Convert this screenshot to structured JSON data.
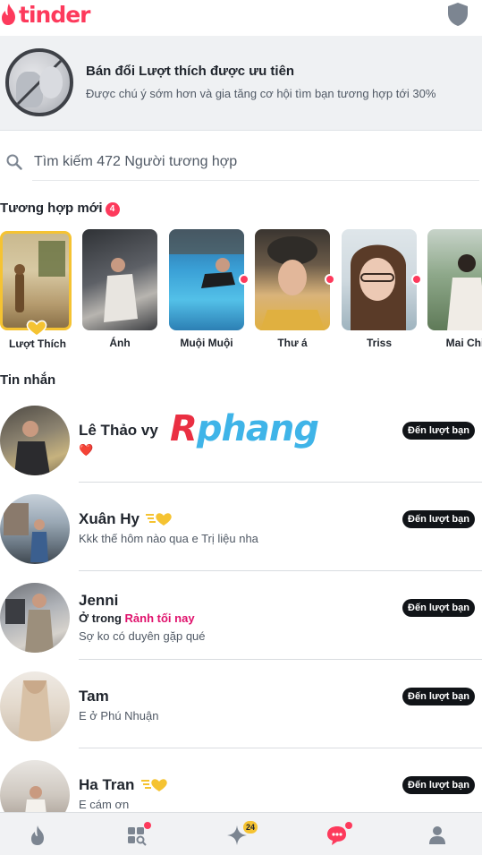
{
  "app": {
    "logo_text": "tinder",
    "brand_color": "#fd3a5c"
  },
  "header": {
    "shield_icon": "shield-icon"
  },
  "promo": {
    "title": "Bán đổi Lượt thích được ưu tiên",
    "subtitle": "Được chú ý sớm hơn và gia tăng cơ hội tìm bạn tương hợp tới 30%"
  },
  "search": {
    "placeholder": "Tìm kiếm 472 Người tương hợp",
    "value": ""
  },
  "new_matches": {
    "title": "Tương hợp mới",
    "count": "4",
    "items": [
      {
        "name": "Lượt Thích",
        "type": "likes",
        "new": false
      },
      {
        "name": "Ánh",
        "new": false
      },
      {
        "name": "Muội Muội",
        "new": true
      },
      {
        "name": "Thư á",
        "new": true
      },
      {
        "name": "Triss",
        "new": true
      },
      {
        "name": "Mai Chi",
        "new": false
      }
    ]
  },
  "messages": {
    "title": "Tin nhắn",
    "turn_label": "Đến lượt bạn",
    "items": [
      {
        "name": "Lê Thảo vy",
        "text": "❤️"
      },
      {
        "name": "Xuân Hy",
        "text": "Kkk thế hôm nào qua e Trị liệu nha",
        "gold": true
      },
      {
        "name": "Jenni",
        "status_prefix": "Ở trong",
        "status_highlight": "Rảnh tối nay",
        "text": "Sợ ko có duyên gặp qué"
      },
      {
        "name": "Tam",
        "text": "E ở Phú Nhuận"
      },
      {
        "name": "Ha Tran",
        "text": "E cám ơn",
        "gold": true
      }
    ]
  },
  "watermark": {
    "r": "R",
    "rest": "phang"
  },
  "bottom_nav": {
    "items": [
      "flame-icon",
      "explore-icon",
      "sparkle-icon",
      "chat-icon",
      "profile-icon"
    ],
    "sparkle_count": "24"
  }
}
